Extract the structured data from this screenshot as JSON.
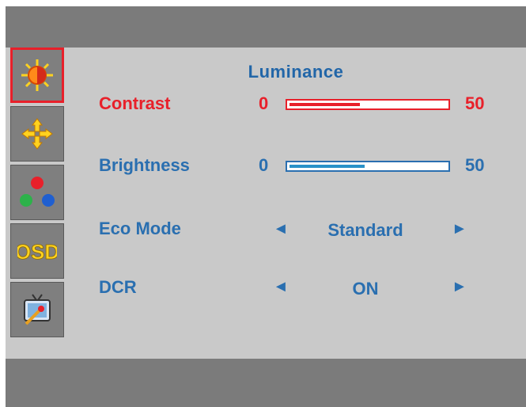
{
  "colors": {
    "accent": "#e8202a",
    "text": "#2a6fb0",
    "panel": "#c9c9c9",
    "frame": "#7b7b7b",
    "brightness_fill": "#2a91c8"
  },
  "sidebar": {
    "tabs": [
      {
        "icon": "sun-icon",
        "selected": true
      },
      {
        "icon": "move-arrows-icon",
        "selected": false
      },
      {
        "icon": "color-dots-icon",
        "selected": false
      },
      {
        "icon": "osd-icon",
        "selected": false,
        "text": "OSD"
      },
      {
        "icon": "tv-tools-icon",
        "selected": false
      }
    ]
  },
  "panel": {
    "title": "Luminance",
    "contrast": {
      "label": "Contrast",
      "min": "0",
      "max": "50",
      "level": 0.45
    },
    "brightness": {
      "label": "Brightness",
      "min": "0",
      "max": "50",
      "level": 0.48
    },
    "eco_mode": {
      "label": "Eco Mode",
      "left_arrow": "◄",
      "value": "Standard",
      "right_arrow": "►"
    },
    "dcr": {
      "label": "DCR",
      "left_arrow": "◄",
      "value": "ON",
      "right_arrow": "►"
    }
  }
}
